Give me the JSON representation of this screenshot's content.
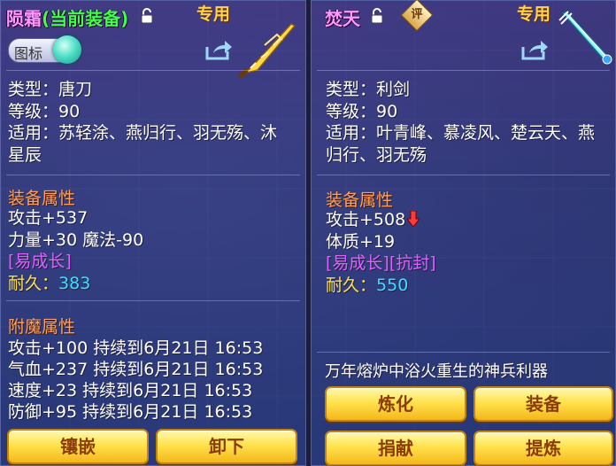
{
  "left": {
    "title_name": "陨霜",
    "title_status": "(当前装备)",
    "exclusive": "专用",
    "icon_toggle_label": "图标",
    "type_line": "类型：唐刀",
    "level_line": "等级：90",
    "suitable_line1": "适用：苏轻涂、燕归行、羽无殇、沐",
    "suitable_line2": "星辰",
    "attr_title": "装备属性",
    "attack": "攻击+537",
    "stats": "力量+30 魔法-90",
    "growth": "[易成长]",
    "durability_label": "耐久：",
    "durability_value": "383",
    "enchant_title": "附魔属性",
    "enchants": [
      "攻击+100 持续到6月21日 16:53",
      "气血+237 持续到6月21日 16:53",
      "速度+23 持续到6月21日 16:53",
      "防御+95 持续到6月21日 16:53"
    ],
    "buttons": [
      "镶嵌",
      "卸下"
    ]
  },
  "right": {
    "title_name": "焚天",
    "eval_badge": "评",
    "exclusive": "专用",
    "type_line": "类型：利剑",
    "level_line": "等级：90",
    "suitable_line1": "适用：叶青峰、慕凌风、楚云天、燕",
    "suitable_line2": "归行、羽无殇",
    "attr_title": "装备属性",
    "attack": "攻击+508",
    "stats": "体质+19",
    "growth": "[易成长][抗封]",
    "durability_label": "耐久：",
    "durability_value": "550",
    "description": "万年熔炉中浴火重生的神兵利器",
    "buttons": [
      "炼化",
      "装备",
      "捐献",
      "提炼"
    ]
  },
  "colors": {
    "title_pink": "#ff99ff",
    "status_green": "#3dff4a",
    "exclusive_gold": "#ffd24a",
    "section_orange": "#ff9f5a",
    "growth_purple": "#e060ff",
    "durability_cyan": "#38e0ff",
    "button_gold": "#ffe24d",
    "decrease_red": "#ff3b3b"
  },
  "icons": [
    "lock-icon",
    "share-icon",
    "weapon-blade-icon",
    "weapon-sword-icon",
    "decrease-arrow-icon",
    "evaluate-badge-icon"
  ]
}
